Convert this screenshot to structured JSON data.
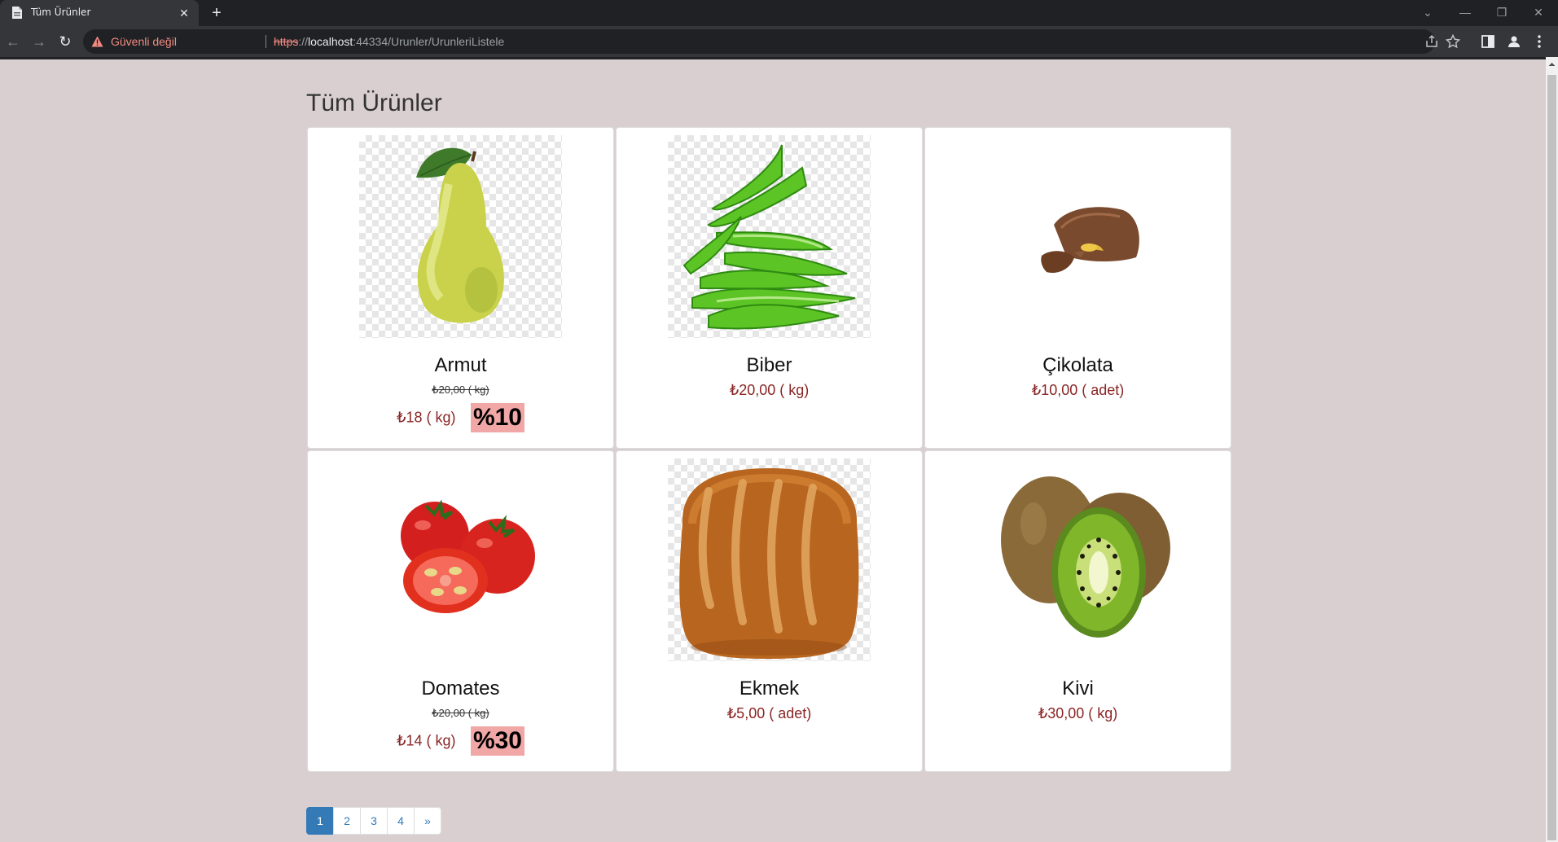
{
  "browser": {
    "tab_title": "Tüm Ürünler",
    "security_warning": "Güvenli değil",
    "url_scheme": "https",
    "url_sep": "://",
    "url_host": "localhost",
    "url_rest": ":44334/Urunler/UrunleriListele"
  },
  "page": {
    "title": "Tüm Ürünler"
  },
  "products": [
    {
      "name": "Armut",
      "old_price": "₺20,00 ( kg)",
      "price": "₺18 ( kg)",
      "discount": "%10",
      "image": "pear"
    },
    {
      "name": "Biber",
      "price": "₺20,00 ( kg)",
      "image": "green-pepper"
    },
    {
      "name": "Çikolata",
      "price": "₺10,00 ( adet)",
      "image": "chocolate"
    },
    {
      "name": "Domates",
      "old_price": "₺20,00 ( kg)",
      "price": "₺14 ( kg)",
      "discount": "%30",
      "image": "tomato"
    },
    {
      "name": "Ekmek",
      "price": "₺5,00 ( adet)",
      "image": "bread"
    },
    {
      "name": "Kivi",
      "price": "₺30,00 ( kg)",
      "image": "kiwi"
    }
  ],
  "pagination": {
    "pages": [
      "1",
      "2",
      "3",
      "4"
    ],
    "next": "»",
    "active": "1"
  },
  "colors": {
    "page_background": "#d9cfd1",
    "price_text": "#8a2525",
    "discount_badge": "#f2a7a7",
    "pagination_active": "#337ab7"
  }
}
